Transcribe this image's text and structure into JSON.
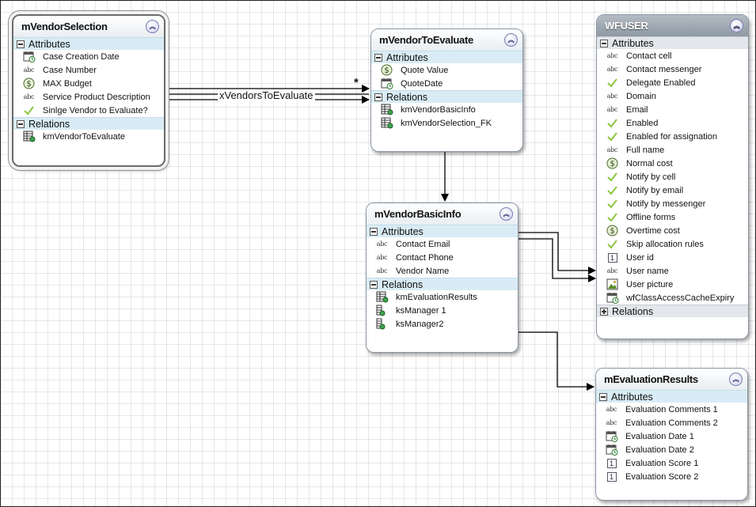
{
  "connection": {
    "label": "xVendorsToEvaluate",
    "multiplicity": "*"
  },
  "entities": {
    "mVendorSelection": {
      "title": "mVendorSelection",
      "sections": {
        "attributes": {
          "label": "Attributes",
          "items": [
            {
              "label": "Case Creation Date",
              "icon": "date-icon"
            },
            {
              "label": "Case Number",
              "icon": "text-icon"
            },
            {
              "label": "MAX Budget",
              "icon": "currency-icon"
            },
            {
              "label": "Service Product Description",
              "icon": "text-icon"
            },
            {
              "label": "Sinlge Vendor to Evaluate?",
              "icon": "boolean-check-icon"
            }
          ]
        },
        "relations": {
          "label": "Relations",
          "items": [
            {
              "label": "kmVendorToEvaluate",
              "icon": "relation-table-icon"
            }
          ]
        }
      }
    },
    "mVendorToEvaluate": {
      "title": "mVendorToEvaluate",
      "sections": {
        "attributes": {
          "label": "Attributes",
          "items": [
            {
              "label": "Quote Value",
              "icon": "currency-icon"
            },
            {
              "label": "QuoteDate",
              "icon": "date-icon"
            }
          ]
        },
        "relations": {
          "label": "Relations",
          "items": [
            {
              "label": "kmVendorBasicInfo",
              "icon": "relation-table-icon"
            },
            {
              "label": "kmVendorSelection_FK",
              "icon": "relation-table-icon"
            }
          ]
        }
      }
    },
    "mVendorBasicInfo": {
      "title": "mVendorBasicInfo",
      "sections": {
        "attributes": {
          "label": "Attributes",
          "items": [
            {
              "label": "Contact Email",
              "icon": "text-icon"
            },
            {
              "label": "Contact Phone",
              "icon": "text-icon"
            },
            {
              "label": "Vendor Name",
              "icon": "text-icon"
            }
          ]
        },
        "relations": {
          "label": "Relations",
          "items": [
            {
              "label": "kmEvaluationResults",
              "icon": "relation-table-icon"
            },
            {
              "label": "ksManager 1",
              "icon": "relation-single-icon"
            },
            {
              "label": "ksManager2",
              "icon": "relation-single-icon"
            }
          ]
        }
      }
    },
    "WFUSER": {
      "title": "WFUSER",
      "sections": {
        "attributes": {
          "label": "Attributes",
          "items": [
            {
              "label": "Contact cell",
              "icon": "text-icon"
            },
            {
              "label": "Contact messenger",
              "icon": "text-icon"
            },
            {
              "label": "Delegate Enabled",
              "icon": "boolean-check-icon"
            },
            {
              "label": "Domain",
              "icon": "text-icon"
            },
            {
              "label": "Email",
              "icon": "text-icon"
            },
            {
              "label": "Enabled",
              "icon": "boolean-check-icon"
            },
            {
              "label": "Enabled for assignation",
              "icon": "boolean-check-icon"
            },
            {
              "label": "Full name",
              "icon": "text-icon"
            },
            {
              "label": "Normal cost",
              "icon": "currency-icon"
            },
            {
              "label": "Notify by cell",
              "icon": "boolean-check-icon"
            },
            {
              "label": "Notify by email",
              "icon": "boolean-check-icon"
            },
            {
              "label": "Notify by messenger",
              "icon": "boolean-check-icon"
            },
            {
              "label": "Offline forms",
              "icon": "boolean-check-icon"
            },
            {
              "label": "Overtime cost",
              "icon": "currency-icon"
            },
            {
              "label": "Skip allocation rules",
              "icon": "boolean-check-icon"
            },
            {
              "label": "User id",
              "icon": "number-icon"
            },
            {
              "label": "User name",
              "icon": "text-icon"
            },
            {
              "label": "User picture",
              "icon": "image-icon"
            },
            {
              "label": "wfClassAccessCacheExpiry",
              "icon": "date-icon"
            }
          ]
        },
        "relations": {
          "label": "Relations",
          "items": []
        }
      }
    },
    "mEvaluationResults": {
      "title": "mEvaluationResults",
      "sections": {
        "attributes": {
          "label": "Attributes",
          "items": [
            {
              "label": "Evaluation Comments 1",
              "icon": "text-icon"
            },
            {
              "label": "Evaluation Comments 2",
              "icon": "text-icon"
            },
            {
              "label": "Evaluation Date 1",
              "icon": "date-icon"
            },
            {
              "label": "Evaluation Date 2",
              "icon": "date-icon"
            },
            {
              "label": "Evaluation Score 1",
              "icon": "number-icon"
            },
            {
              "label": "Evaluation Score 2",
              "icon": "number-icon"
            }
          ]
        }
      }
    }
  }
}
